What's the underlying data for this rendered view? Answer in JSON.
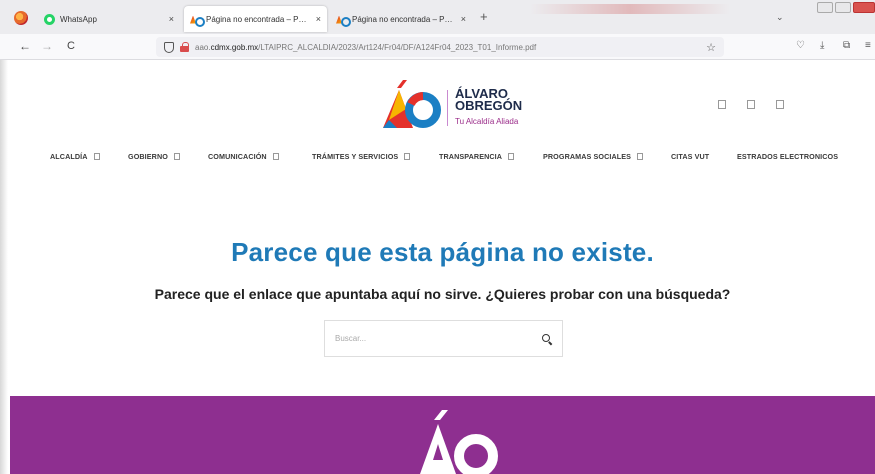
{
  "browser": {
    "tabs": [
      {
        "title": "WhatsApp",
        "icon": "whatsapp-icon",
        "active": false
      },
      {
        "title": "Página no encontrada – Página",
        "icon": "alcaldia-favicon-icon",
        "active": true
      },
      {
        "title": "Página no encontrada – Página",
        "icon": "alcaldia-favicon-icon",
        "active": false
      }
    ],
    "url_prefix": "aao.",
    "url_domain": "cdmx.gob.mx",
    "url_path": "/LTAIPRC_ALCALDIA/2023/Art124/Fr04/DF/A124Fr04_2023_T01_Informe.pdf",
    "close_glyph": "×",
    "newtab_glyph": "+",
    "tabs_list_glyph": "⌄",
    "back_glyph": "←",
    "forward_glyph": "→",
    "reload_glyph": "C",
    "star_glyph": "☆",
    "pocket_glyph": "♡",
    "download_glyph": "⤓",
    "extensions_glyph": "⧉",
    "menu_glyph": "≡"
  },
  "site": {
    "logo_line1": "ÁLVARO",
    "logo_line2": "OBREGÓN",
    "logo_tagline": "Tu Alcaldía Aliada",
    "brand_colors": {
      "purple": "#8e2f90",
      "blue": "#1f7ab7",
      "red": "#e4312b",
      "yellow": "#f7b500"
    },
    "menu": [
      {
        "label": "ALCALDÍA",
        "has_dropdown": true
      },
      {
        "label": "GOBIERNO",
        "has_dropdown": true
      },
      {
        "label": "COMUNICACIÓN",
        "has_dropdown": true
      },
      {
        "label": "TRÁMITES Y SERVICIOS",
        "has_dropdown": true
      },
      {
        "label": "TRANSPARENCIA",
        "has_dropdown": true
      },
      {
        "label": "PROGRAMAS SOCIALES",
        "has_dropdown": true
      },
      {
        "label": "CITAS VUT",
        "has_dropdown": false
      },
      {
        "label": "ESTRADOS ELECTRONICOS",
        "has_dropdown": false
      }
    ]
  },
  "error": {
    "title": "Parece que esta página no existe.",
    "subtitle": "Parece que el enlace que apuntaba aquí no sirve. ¿Quieres probar con una búsqueda?",
    "search_placeholder": "Buscar..."
  }
}
